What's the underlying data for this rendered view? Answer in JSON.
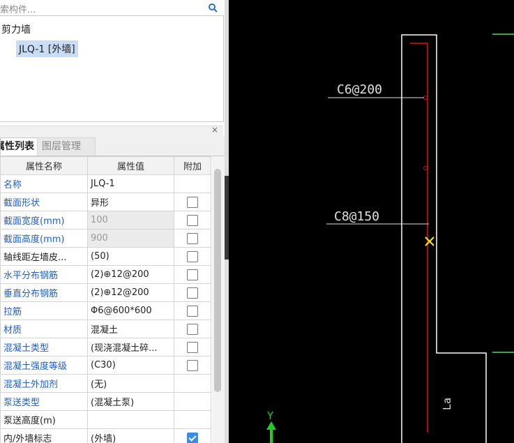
{
  "search": {
    "placeholder": "索构件..."
  },
  "tree": {
    "root": "剪力墙",
    "selected": "JLQ-1 [外墙]"
  },
  "tabs": [
    {
      "label": "属性列表"
    },
    {
      "label": "图层管理"
    }
  ],
  "grid": {
    "headers": [
      "属性名称",
      "属性值",
      "附加"
    ],
    "rows": [
      {
        "name": "名称",
        "value": "JLQ-1",
        "checkbox": "none",
        "name_color": "blue",
        "disabled": false
      },
      {
        "name": "截面形状",
        "value": "异形",
        "checkbox": "off",
        "name_color": "blue",
        "disabled": false
      },
      {
        "name": "截面宽度(mm)",
        "value": "100",
        "checkbox": "off",
        "name_color": "blue",
        "disabled": true
      },
      {
        "name": "截面高度(mm)",
        "value": "900",
        "checkbox": "off",
        "name_color": "blue",
        "disabled": true
      },
      {
        "name": "轴线距左墙皮...",
        "value": "(50)",
        "checkbox": "off",
        "name_color": "black",
        "disabled": false
      },
      {
        "name": "水平分布钢筋",
        "value": "(2)⊕12@200",
        "checkbox": "off",
        "name_color": "blue",
        "disabled": false
      },
      {
        "name": "垂直分布钢筋",
        "value": "(2)⊕12@200",
        "checkbox": "off",
        "name_color": "blue",
        "disabled": false
      },
      {
        "name": "拉筋",
        "value": "Φ6@600*600",
        "checkbox": "off",
        "name_color": "blue",
        "disabled": false
      },
      {
        "name": "材质",
        "value": "混凝土",
        "checkbox": "off",
        "name_color": "blue",
        "disabled": false
      },
      {
        "name": "混凝土类型",
        "value": "(现浇混凝土碎...",
        "checkbox": "off",
        "name_color": "blue",
        "disabled": false
      },
      {
        "name": "混凝土强度等级",
        "value": "(C30)",
        "checkbox": "off",
        "name_color": "blue",
        "disabled": false
      },
      {
        "name": "混凝土外加剂",
        "value": "(无)",
        "checkbox": "none",
        "name_color": "blue",
        "disabled": false
      },
      {
        "name": "泵送类型",
        "value": "(混凝土泵)",
        "checkbox": "none",
        "name_color": "blue",
        "disabled": false
      },
      {
        "name": "泵送高度(m)",
        "value": "",
        "checkbox": "none",
        "name_color": "black",
        "disabled": false
      },
      {
        "name": "内/外墙标志",
        "value": "(外墙)",
        "checkbox": "on",
        "name_color": "black",
        "disabled": false
      }
    ]
  },
  "cad": {
    "label_top": "C6@200",
    "label_mid": "C8@150",
    "label_la": "La",
    "axis_y": "Y",
    "colors": {
      "wall": "#ffffff",
      "rebar": "#e01010",
      "leader": "#e0e0e0",
      "marker": "#ffee00",
      "edge": "#3fa34d",
      "axis": "#22cc22"
    }
  },
  "icons": {
    "search": "search-icon",
    "close": "close-icon",
    "check": "checkbox-icon",
    "marker": "x-marker-icon",
    "axis": "y-axis-arrow-icon"
  }
}
